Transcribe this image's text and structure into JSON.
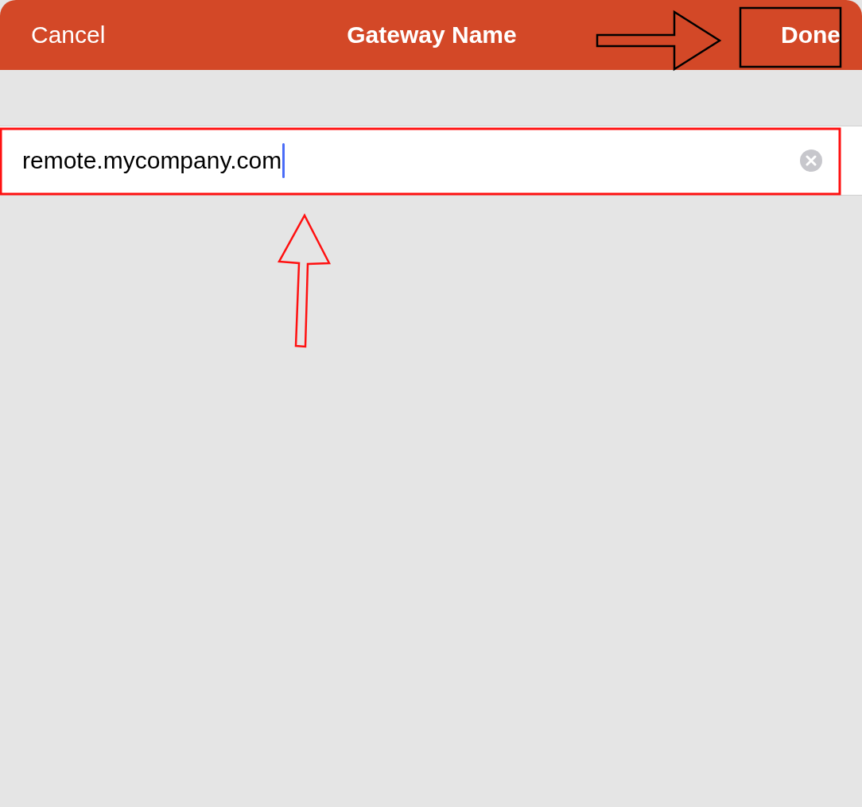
{
  "nav_bar": {
    "cancel": "Cancel",
    "title": "Gateway Name",
    "done": "Done"
  },
  "field": {
    "value": "remote.mycompany.com",
    "focused": true
  }
}
